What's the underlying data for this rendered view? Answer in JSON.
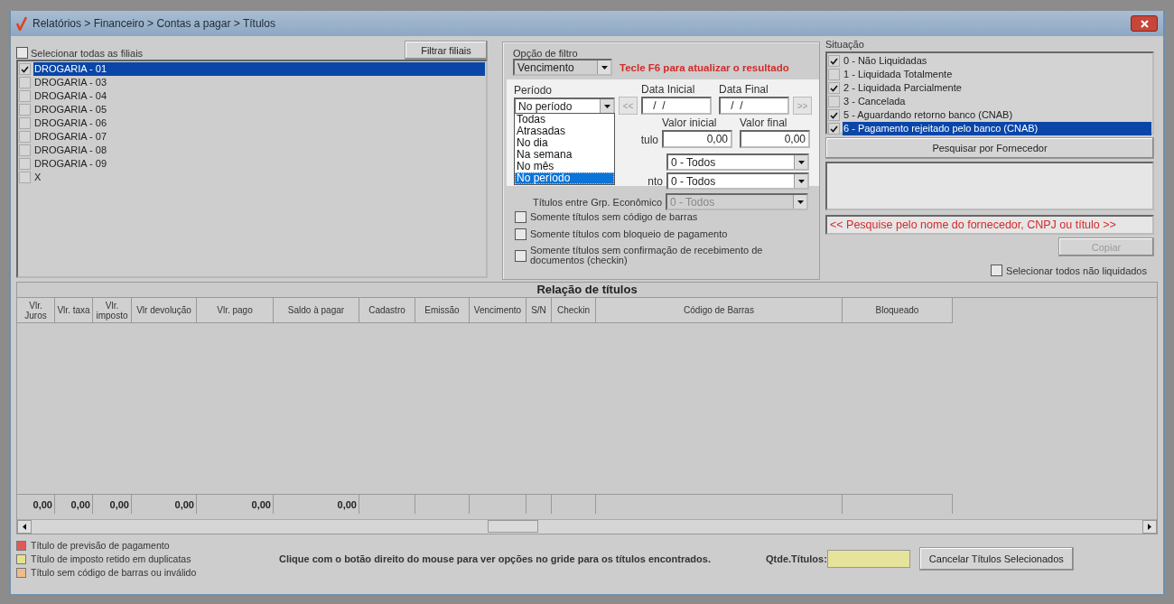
{
  "window": {
    "title": "Relatórios > Financeiro > Contas a pagar > Títulos"
  },
  "branches": {
    "select_all": {
      "label": "Selecionar todas as filiais",
      "checked": false
    },
    "filter_button": "Filtrar filiais",
    "items": [
      {
        "label": "DROGARIA - 01",
        "checked": true,
        "selected": true
      },
      {
        "label": "DROGARIA - 03",
        "checked": false,
        "selected": false
      },
      {
        "label": "DROGARIA - 04",
        "checked": false,
        "selected": false
      },
      {
        "label": "DROGARIA - 05",
        "checked": false,
        "selected": false
      },
      {
        "label": "DROGARIA - 06",
        "checked": false,
        "selected": false
      },
      {
        "label": "DROGARIA - 07",
        "checked": false,
        "selected": false
      },
      {
        "label": "DROGARIA - 08",
        "checked": false,
        "selected": false
      },
      {
        "label": "DROGARIA - 09",
        "checked": false,
        "selected": false
      },
      {
        "label": "X",
        "checked": false,
        "selected": false
      }
    ]
  },
  "filter": {
    "option_label": "Opção de filtro",
    "option_value": "Vencimento",
    "hint": "Tecle F6 para atualizar o resultado",
    "period_label": "Período",
    "period_value": "No período",
    "period_options": [
      {
        "label": "Todas",
        "selected": false
      },
      {
        "label": "Atrasadas",
        "selected": false
      },
      {
        "label": "No dia",
        "selected": false
      },
      {
        "label": "Na semana",
        "selected": false
      },
      {
        "label": "No mês",
        "selected": false
      },
      {
        "label": "No período",
        "selected": true
      }
    ],
    "prev_button": "<<",
    "next_button": ">>",
    "start_date_label": "Data Inicial",
    "start_date": " /  /",
    "end_date_label": "Data Final",
    "end_date": " /  /",
    "value_start_label": "Valor inicial",
    "value_start": "0,00",
    "value_end_label": "Valor final",
    "value_end": "0,00",
    "row_label_fragment_1": "tulo",
    "select_1": "0 - Todos",
    "row_label_fragment_2": "nto",
    "select_2": "0 - Todos",
    "group_label": "Títulos entre Grp. Econômico",
    "group_select": "0 - Todos",
    "checkboxes": [
      {
        "label": "Somente títulos sem código de barras",
        "checked": false
      },
      {
        "label": "Somente títulos com bloqueio de pagamento",
        "checked": false
      },
      {
        "label": "Somente títulos sem confirmação de recebimento de documentos (checkin)",
        "checked": false
      }
    ]
  },
  "status": {
    "label": "Situação",
    "items": [
      {
        "label": "0 - Não Liquidadas",
        "checked": true,
        "selected": false
      },
      {
        "label": "1 - Liquidada Totalmente",
        "checked": false,
        "selected": false
      },
      {
        "label": "2 - Liquidada Parcialmente",
        "checked": true,
        "selected": false
      },
      {
        "label": "3 - Cancelada",
        "checked": false,
        "selected": false
      },
      {
        "label": "5 - Aguardando retorno banco (CNAB)",
        "checked": true,
        "selected": false
      },
      {
        "label": "6 - Pagamento rejeitado pelo banco (CNAB)",
        "checked": true,
        "selected": true
      }
    ]
  },
  "supplier_button": "Pesquisar por Fornecedor",
  "supplier_hint": "<< Pesquise pelo nome do fornecedor, CNPJ ou título >>",
  "copy_button": {
    "label": "Copiar",
    "disabled": true
  },
  "select_unpaid": {
    "label": "Selecionar todos não liquidados",
    "checked": false
  },
  "table": {
    "title": "Relação de títulos",
    "columns": [
      {
        "label": "Vlr. Juros",
        "total": "0,00"
      },
      {
        "label": "Vlr. taxa",
        "total": "0,00"
      },
      {
        "label": "Vlr. imposto",
        "total": "0,00"
      },
      {
        "label": "Vlr devolução",
        "total": "0,00"
      },
      {
        "label": "Vlr. pago",
        "total": "0,00"
      },
      {
        "label": "Saldo à pagar",
        "total": "0,00"
      },
      {
        "label": "Cadastro"
      },
      {
        "label": "Emissão"
      },
      {
        "label": "Vencimento"
      },
      {
        "label": "S/N"
      },
      {
        "label": "Checkin"
      },
      {
        "label": "Código de Barras"
      },
      {
        "label": "Bloqueado"
      }
    ]
  },
  "legend": [
    {
      "label": "Título de previsão de pagamento",
      "color": "#e05a5a"
    },
    {
      "label": "Título de imposto retido em duplicatas",
      "color": "#e6e28c"
    },
    {
      "label": "Título sem código de barras ou inválido",
      "color": "#eebc8c"
    }
  ],
  "footer_note": "Clique com o botão direito do mouse para ver opções no gride para os títulos encontrados.",
  "count_label": "Qtde.Títulos:",
  "cancel_button": "Cancelar Títulos Selecionados"
}
